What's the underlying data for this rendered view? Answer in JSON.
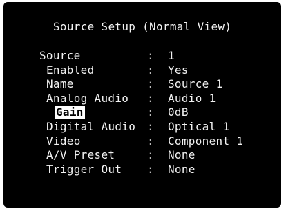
{
  "screen": {
    "title": "Source Setup (Normal View)"
  },
  "menu": {
    "rows": [
      {
        "label": "Source",
        "separator": ":",
        "value": "1"
      },
      {
        "label": "Enabled",
        "separator": ":",
        "value": "Yes"
      },
      {
        "label": "Name",
        "separator": ":",
        "value": "Source 1"
      },
      {
        "label": "Analog Audio",
        "separator": ":",
        "value": "Audio 1"
      },
      {
        "label": "Gain",
        "separator": ":",
        "value": "0dB",
        "selected": true
      },
      {
        "label": "Digital Audio",
        "separator": ":",
        "value": "Optical 1"
      },
      {
        "label": "Video",
        "separator": ":",
        "value": "Component 1"
      },
      {
        "label": "A/V Preset",
        "separator": ":",
        "value": "None"
      },
      {
        "label": "Trigger Out",
        "separator": ":",
        "value": "None"
      }
    ]
  },
  "colors": {
    "background": "#000000",
    "text": "#f2f2f2",
    "selection_background": "#ffffff",
    "selection_text": "#000000"
  }
}
